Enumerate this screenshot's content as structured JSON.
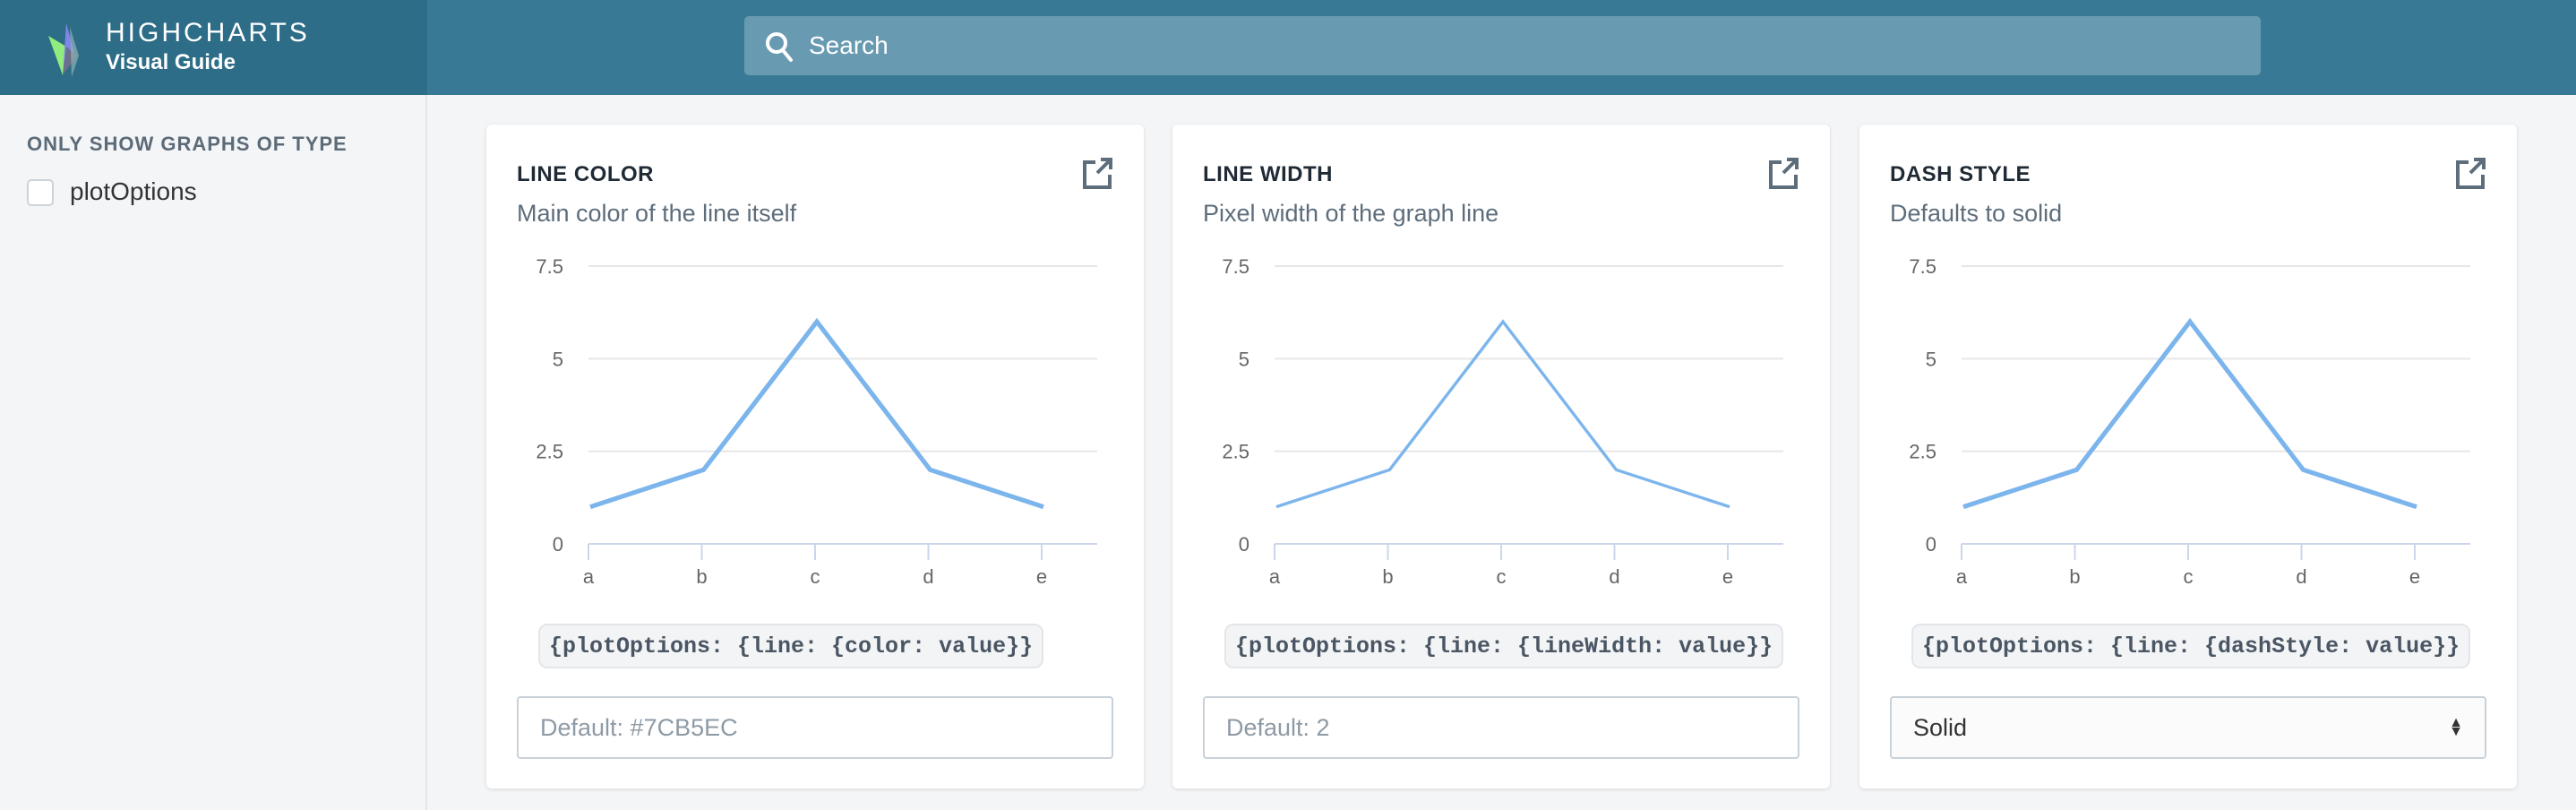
{
  "header": {
    "brand_name": "HIGHCHARTS",
    "brand_sub": "Visual Guide",
    "search_placeholder": "Search"
  },
  "sidebar": {
    "title": "ONLY SHOW GRAPHS OF TYPE",
    "filters": [
      {
        "label": "plotOptions",
        "checked": false
      }
    ]
  },
  "cards": [
    {
      "title": "LINE COLOR",
      "description": "Main color of the line itself",
      "code": "{plotOptions: {line: {color: value}}",
      "input_placeholder": "Default: #7CB5EC",
      "line_width": 3
    },
    {
      "title": "LINE WIDTH",
      "description": "Pixel width of the graph line",
      "code": "{plotOptions: {line: {lineWidth: value}}",
      "input_placeholder": "Default: 2",
      "line_width": 2
    },
    {
      "title": "DASH STYLE",
      "description": "Defaults to solid",
      "code": "{plotOptions: {line: {dashStyle: value}}",
      "select_value": "Solid",
      "line_width": 3
    }
  ],
  "chart_data": {
    "type": "line",
    "categories": [
      "a",
      "b",
      "c",
      "d",
      "e"
    ],
    "values": [
      1,
      2,
      6,
      2,
      1
    ],
    "yticks": [
      "0",
      "2.5",
      "5",
      "7.5"
    ],
    "ylim": [
      0,
      7.5
    ],
    "color": "#7CB5EC",
    "grid": true
  }
}
